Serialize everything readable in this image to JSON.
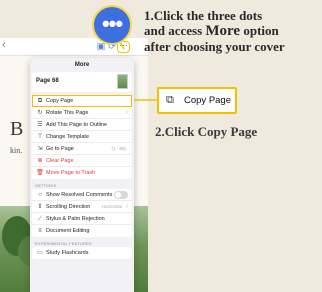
{
  "callouts": {
    "dots_glyph": "•••",
    "step1_line1": "1.Click the three dots",
    "step1_line2_a": "and access ",
    "step1_line2_b": "More",
    "step1_line2_c": " option",
    "step1_line3": "after choosing your cover",
    "highlight_label": "Copy Page",
    "step2": "2.Click Copy Page"
  },
  "app": {
    "back_glyph": "‹",
    "doc_letter": "B",
    "doc_small": "kin."
  },
  "menu": {
    "title": "More",
    "page_label": "Page 68",
    "group1": [
      {
        "icon": "copy-icon",
        "glyph": "⧉",
        "label": "Copy Page"
      },
      {
        "icon": "rotate-icon",
        "glyph": "↻",
        "label": "Rotate This Page",
        "chevron": "›"
      },
      {
        "icon": "outline-icon",
        "glyph": "☰",
        "label": "Add This Page to Outline"
      },
      {
        "icon": "template-icon",
        "glyph": "⊤",
        "label": "Change Template"
      },
      {
        "icon": "goto-icon",
        "glyph": "⇲",
        "label": "Go to Page",
        "hint": "(1 - 85)"
      },
      {
        "icon": "clear-icon",
        "glyph": "⊗",
        "label": "Clear Page",
        "danger": true
      },
      {
        "icon": "trash-icon",
        "glyph": "🗑",
        "label": "Move Page to Trash",
        "danger": true
      }
    ],
    "settings_header": "SETTINGS",
    "group2": [
      {
        "icon": "comments-icon",
        "glyph": "○",
        "label": "Show Resolved Comments",
        "toggle": false
      },
      {
        "icon": "scroll-icon",
        "glyph": "⇕",
        "label": "Scrolling Direction",
        "value": "Horizontal",
        "chevron": "›"
      },
      {
        "icon": "stylus-icon",
        "glyph": "⟋",
        "label": "Stylus & Palm Rejection"
      },
      {
        "icon": "editing-icon",
        "glyph": "≡",
        "label": "Document Editing"
      }
    ],
    "experimental_header": "EXPERIMENTAL FEATURES",
    "group3": [
      {
        "icon": "flashcards-icon",
        "glyph": "▭",
        "label": "Study Flashcards"
      }
    ]
  },
  "colors": {
    "accent_yellow": "#f2c200",
    "dots_blue": "#3d6fe0",
    "danger_red": "#e03a3a"
  }
}
